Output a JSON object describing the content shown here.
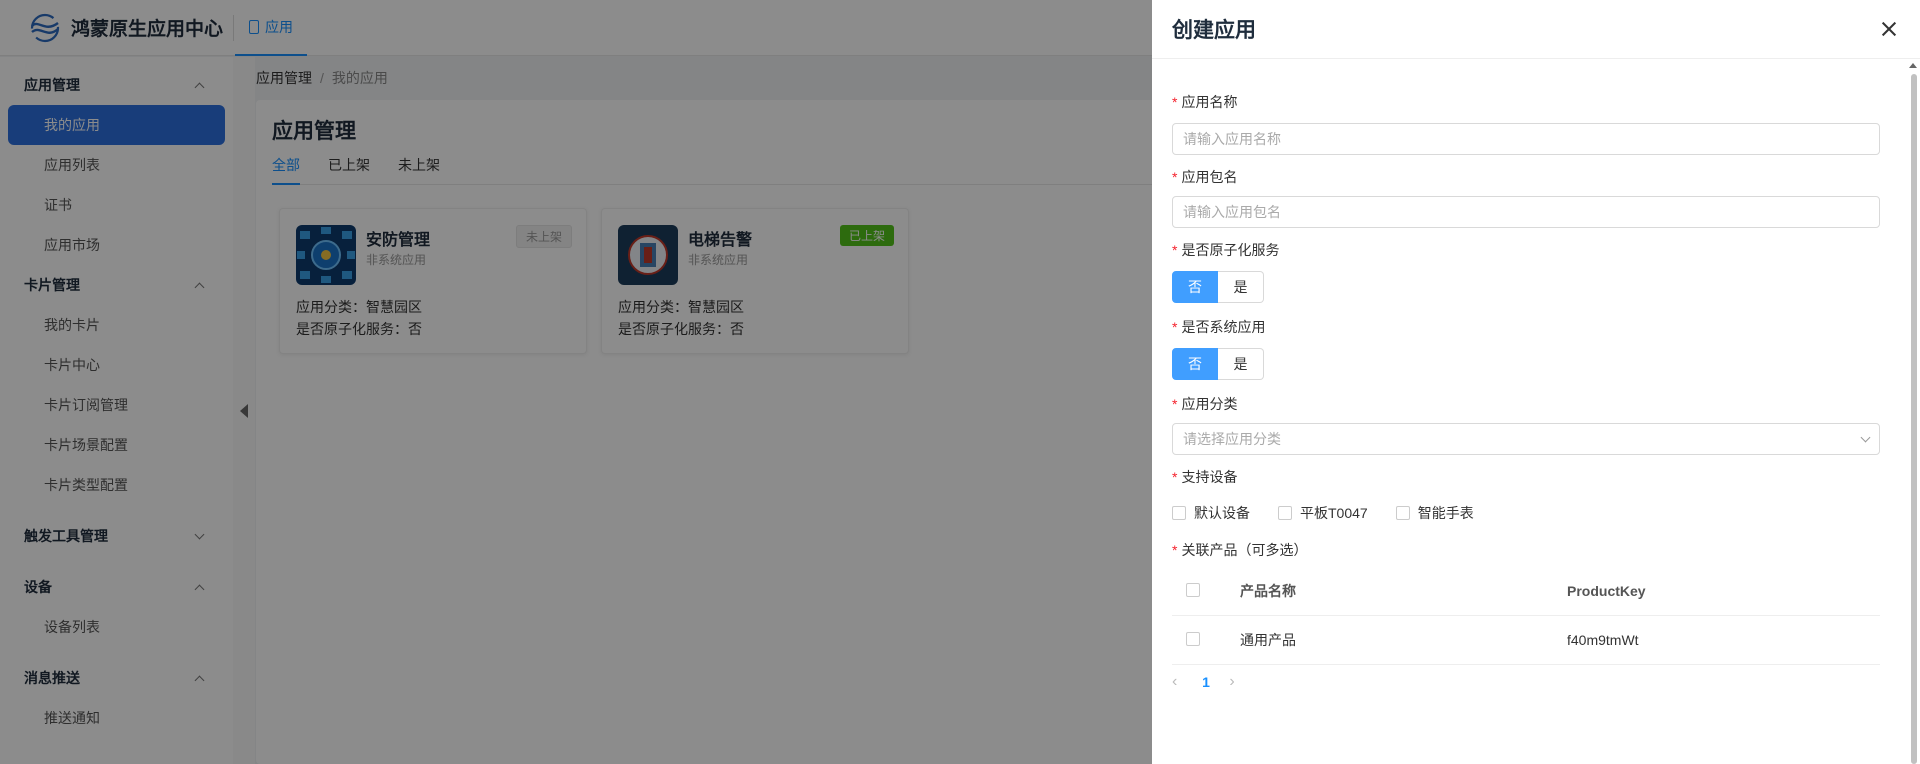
{
  "brand": {
    "name": "鸿蒙原生应用中心"
  },
  "top_nav": {
    "tab_label": "应用"
  },
  "sidebar": {
    "groups": [
      {
        "label": "应用管理",
        "expanded": true,
        "items": [
          "我的应用",
          "应用列表",
          "证书",
          "应用市场"
        ]
      },
      {
        "label": "卡片管理",
        "expanded": true,
        "items": [
          "我的卡片",
          "卡片中心",
          "卡片订阅管理",
          "卡片场景配置",
          "卡片类型配置"
        ]
      },
      {
        "label": "触发工具管理",
        "expanded": false,
        "items": []
      },
      {
        "label": "设备",
        "expanded": true,
        "items": [
          "设备列表"
        ]
      },
      {
        "label": "消息推送",
        "expanded": true,
        "items": [
          "推送通知"
        ]
      }
    ],
    "active_item": "我的应用"
  },
  "breadcrumb": [
    "应用管理",
    "我的应用"
  ],
  "main": {
    "title": "应用管理",
    "tabs": [
      "全部",
      "已上架",
      "未上架"
    ],
    "active_tab": "全部",
    "apps": [
      {
        "name": "安防管理",
        "type": "非系统应用",
        "status": "未上架",
        "category_line": "应用分类：智慧园区",
        "atomic_line": "是否原子化服务：否"
      },
      {
        "name": "电梯告警",
        "type": "非系统应用",
        "status": "已上架",
        "category_line": "应用分类：智慧园区",
        "atomic_line": "是否原子化服务：否"
      }
    ]
  },
  "drawer": {
    "title": "创建应用",
    "fields": {
      "app_name": {
        "label": "应用名称",
        "placeholder": "请输入应用名称"
      },
      "package_name": {
        "label": "应用包名",
        "placeholder": "请输入应用包名"
      },
      "atomic_service": {
        "label": "是否原子化服务",
        "options": [
          "否",
          "是"
        ],
        "selected": "否"
      },
      "system_app": {
        "label": "是否系统应用",
        "options": [
          "否",
          "是"
        ],
        "selected": "否"
      },
      "category": {
        "label": "应用分类",
        "placeholder": "请选择应用分类"
      },
      "devices": {
        "label": "支持设备",
        "options": [
          "默认设备",
          "平板T0047",
          "智能手表"
        ]
      },
      "products": {
        "label": "关联产品（可多选）",
        "columns": [
          "产品名称",
          "ProductKey"
        ],
        "rows": [
          {
            "name": "通用产品",
            "key": "f40m9tmWt"
          }
        ]
      }
    },
    "pagination": {
      "current_page": "1",
      "prev": "‹",
      "next": "›"
    }
  },
  "colors": {
    "primary": "#1890ff",
    "active_menu": "#2c6fde",
    "toggle_on": "#409eff",
    "status_on": "#52c41a",
    "required": "#f5222d"
  }
}
